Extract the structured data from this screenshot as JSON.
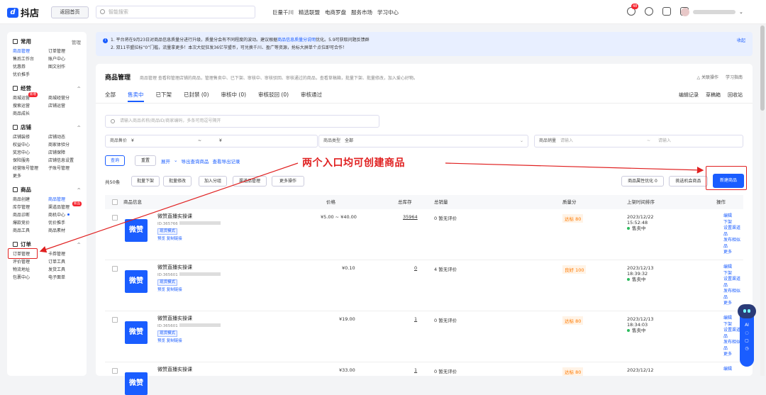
{
  "topbar": {
    "logo": "抖店",
    "home_button": "返回首页",
    "search_placeholder": "智能搜索",
    "nav": [
      "巨量千川",
      "精选联盟",
      "电商罗盘",
      "服务市场",
      "学习中心"
    ],
    "bell_badge": "48"
  },
  "sidebar": {
    "sections": [
      {
        "title": "常用",
        "right": "管理",
        "items": [
          "商品管理",
          "订单管理",
          "售后工作台",
          "账户中心",
          "优惠券",
          "图文创作",
          "优价推手"
        ]
      },
      {
        "title": "经营",
        "right": "^",
        "items": [
          "商城运营",
          "商城经营分",
          "搜索运营",
          "店铺运营",
          "商品成长"
        ],
        "new_tag": "新增"
      },
      {
        "title": "店铺",
        "right": "^",
        "items": [
          "店铺装修",
          "店铺动态",
          "权益中心",
          "商家体验分",
          "奖惩中心",
          "店铺保障",
          "保险服务",
          "店铺信息设置",
          "经营账号管理",
          "子账号管理",
          "更多"
        ]
      },
      {
        "title": "商品",
        "right": "^",
        "items": [
          "商品创建",
          "商品管理",
          "库存管理",
          "渠道品管理",
          "商品诊断",
          "商机中心",
          "爆款竞价",
          "优价推手",
          "商品工具",
          "商品素材"
        ],
        "hot_tag": "新品"
      },
      {
        "title": "订单",
        "right": "^",
        "items": [
          "订单管理",
          "卡券管理",
          "评价管理",
          "订单工具",
          "物流地址",
          "发货工具",
          "包裹中心",
          "电子面单"
        ]
      }
    ]
  },
  "notice": {
    "line1_prefix": "1. 平台将在9月23日对商品信息质量分进行升级，质量分会有不同程度的波动。建议根据",
    "line1_link": "商品信息质量分说明",
    "line1_suffix": "优化。5.9可获取问题反馈群",
    "line2": "2. 双11节盟拉标“0”门槛，流量拿更多！本次大促狂发36亿节盟币，可兑换千川、盈广等资源，抢标大屏单个点位即可合作！",
    "fold": "收起"
  },
  "main": {
    "title": "商品管理",
    "desc": "商品管理 查看和管理店铺的商品，管理售卖中、已下架、审核中、审核驳回、审核通过的商品，查看草稿箱，批量下架、批量修改，加入爱心好物。",
    "right_links": [
      "△ 关联操作",
      "学习指南"
    ],
    "tabs": [
      "全部",
      "售卖中",
      "已下架",
      "已封禁 (0)",
      "审核中 (0)",
      "审核驳回 (0)",
      "审核通过"
    ],
    "tab_right": [
      "编辑记录",
      "草稿箱",
      "回收站"
    ],
    "search_placeholder": "请输入商品名称/商品ID/商家编码，多条可用逗号隔开",
    "filters": {
      "price_label": "商品售价",
      "price_from": "¥",
      "price_sep": "~",
      "price_to": "¥",
      "type_label": "商品类型",
      "type_value": "全部",
      "sales_label": "商品销量",
      "sales_from": "请输入",
      "sales_sep": "~",
      "sales_to": "请输入"
    },
    "query_btn": "查询",
    "reset_btn": "重置",
    "expand": "展开",
    "export": "导出查询商品",
    "export_log": "查看导出记录",
    "total": "共50条",
    "bulk_btns": [
      "批量下架",
      "批量修改",
      "加入分组",
      "渠道品管理",
      "更多操作"
    ],
    "right_btns": [
      "商品属性优化 0",
      "挑选机会商品"
    ],
    "new_btn": "新建商品",
    "columns": [
      "商品信息",
      "价格",
      "总库存",
      "总销量",
      "质量分",
      "上架时间排序",
      "操作"
    ],
    "rows": [
      {
        "name": "微赞直播实操课",
        "id": "ID:365766",
        "tag": "现货模式",
        "links": "预览  复制链接",
        "price": "¥5.00 ~ ¥40.00",
        "stock": "35964",
        "sales": "0",
        "review": "暂无评价",
        "quality": "达标 80",
        "date": "2023/12/22",
        "time": "15:52:48",
        "status": "售卖中"
      },
      {
        "name": "微赞直播实操课",
        "id": "ID:365601",
        "tag": "现货模式",
        "links": "预览  复制链接",
        "price": "¥0.10",
        "stock": "0",
        "sales": "4",
        "review": "暂无评价",
        "quality": "良好 100",
        "date": "2023/12/13",
        "time": "18:39:32",
        "status": "售卖中"
      },
      {
        "name": "微赞直播实操课",
        "id": "ID:365601",
        "tag": "现货模式",
        "links": "预览  复制链接",
        "price": "¥19.00",
        "stock": "1",
        "sales": "0",
        "review": "暂无评价",
        "quality": "达标 80",
        "date": "2023/12/13",
        "time": "18:34:03",
        "status": "售卖中"
      },
      {
        "name": "微赞直播实操课",
        "id": "",
        "tag": "",
        "links": "",
        "price": "¥33.00",
        "stock": "1",
        "sales": "0",
        "review": "暂无评价",
        "quality": "达标 80",
        "date": "2023/12/12",
        "time": "",
        "status": ""
      }
    ],
    "ops": [
      "编辑",
      "下架",
      "设置渠道品",
      "发布相似品",
      "更多"
    ],
    "thumb_text": "微赞"
  },
  "annotation": "两个入口均可创建商品",
  "ai": {
    "label": "AI"
  },
  "colors": {
    "accent": "#1a5dff",
    "annotation": "#e02020"
  }
}
